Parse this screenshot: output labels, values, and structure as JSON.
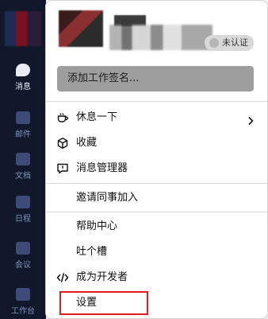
{
  "sidebar": {
    "items": [
      {
        "label": "消息",
        "icon": "chat-bubble-icon",
        "active": true
      },
      {
        "label": "邮件",
        "icon": "mail-icon",
        "active": false
      },
      {
        "label": "文档",
        "icon": "document-icon",
        "active": false
      },
      {
        "label": "日程",
        "icon": "calendar-icon",
        "active": false
      },
      {
        "label": "会议",
        "icon": "video-meeting-icon",
        "active": false
      },
      {
        "label": "工作台",
        "icon": "workbench-icon",
        "active": false
      }
    ]
  },
  "profile": {
    "verification_badge": "未认证",
    "signature_placeholder": "添加工作签名..."
  },
  "menu": {
    "rest": "休息一下",
    "favorites": "收藏",
    "message_manager": "消息管理器",
    "invite": "邀请同事加入",
    "help": "帮助中心",
    "feedback": "吐个槽",
    "developer": "成为开发者",
    "settings": "设置"
  },
  "colors": {
    "highlight": "#e31b1b",
    "sidebar_bg": "#12182b",
    "signature_bg": "#9e9e9e"
  }
}
